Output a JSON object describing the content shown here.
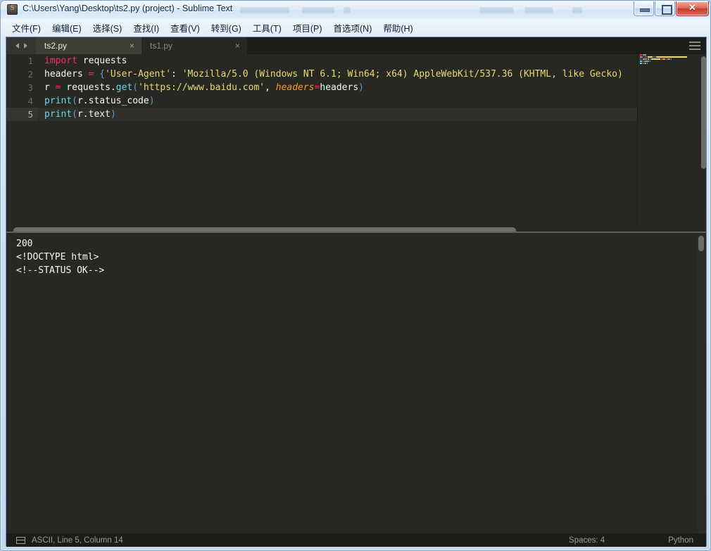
{
  "window": {
    "title": "C:\\Users\\Yang\\Desktop\\ts2.py (project) - Sublime Text",
    "app_icon": "sublime-text-icon",
    "buttons": {
      "minimize": "–",
      "maximize": "□",
      "close": "✕"
    }
  },
  "menu": {
    "items": [
      {
        "label": "文件(F)",
        "mnemonic": "F"
      },
      {
        "label": "编辑(E)",
        "mnemonic": "E"
      },
      {
        "label": "选择(S)",
        "mnemonic": "S"
      },
      {
        "label": "查找(I)",
        "mnemonic": "I"
      },
      {
        "label": "查看(V)",
        "mnemonic": "V"
      },
      {
        "label": "转到(G)",
        "mnemonic": "G"
      },
      {
        "label": "工具(T)",
        "mnemonic": "T"
      },
      {
        "label": "项目(P)",
        "mnemonic": "P"
      },
      {
        "label": "首选项(N)",
        "mnemonic": "N"
      },
      {
        "label": "帮助(H)",
        "mnemonic": "H"
      }
    ]
  },
  "tabs": {
    "nav_prev_icon": "chevron-left-icon",
    "nav_next_icon": "chevron-right-icon",
    "menu_icon": "hamburger-menu-icon",
    "close_icon": "×",
    "items": [
      {
        "label": "ts2.py",
        "active": true
      },
      {
        "label": "ts1.py",
        "active": false
      }
    ]
  },
  "editor": {
    "line_numbers": [
      "1",
      "2",
      "3",
      "4",
      "5"
    ],
    "current_line": 5,
    "lines": [
      {
        "n": 1,
        "tokens": [
          {
            "t": "import",
            "c": "k-import"
          },
          {
            "t": " requests",
            "c": "k-plain"
          }
        ]
      },
      {
        "n": 2,
        "tokens": [
          {
            "t": "headers ",
            "c": "k-plain"
          },
          {
            "t": "=",
            "c": "k-op"
          },
          {
            "t": " ",
            "c": "k-plain"
          },
          {
            "t": "{",
            "c": "k-punct"
          },
          {
            "t": "'User-Agent'",
            "c": "k-str"
          },
          {
            "t": ":",
            "c": "k-plain"
          },
          {
            "t": " ",
            "c": "k-plain"
          },
          {
            "t": "'Mozilla/5.0 (Windows NT 6.1; Win64; x64) AppleWebKit/537.36 (KHTML, like Gecko)",
            "c": "k-str"
          }
        ]
      },
      {
        "n": 3,
        "tokens": [
          {
            "t": "r ",
            "c": "k-plain"
          },
          {
            "t": "=",
            "c": "k-op"
          },
          {
            "t": " requests.",
            "c": "k-plain"
          },
          {
            "t": "get",
            "c": "k-call"
          },
          {
            "t": "(",
            "c": "k-punct"
          },
          {
            "t": "'https://www.baidu.com'",
            "c": "k-str"
          },
          {
            "t": ", ",
            "c": "k-plain"
          },
          {
            "t": "headers",
            "c": "k-param"
          },
          {
            "t": "=",
            "c": "k-op"
          },
          {
            "t": "headers",
            "c": "k-plain"
          },
          {
            "t": ")",
            "c": "k-punct"
          }
        ]
      },
      {
        "n": 4,
        "tokens": [
          {
            "t": "print",
            "c": "k-fn"
          },
          {
            "t": "(",
            "c": "k-punct"
          },
          {
            "t": "r.status_code",
            "c": "k-plain"
          },
          {
            "t": ")",
            "c": "k-punct"
          }
        ]
      },
      {
        "n": 5,
        "tokens": [
          {
            "t": "print",
            "c": "k-fn"
          },
          {
            "t": "(",
            "c": "k-punct"
          },
          {
            "t": "r.text",
            "c": "k-plain"
          },
          {
            "t": ")",
            "c": "k-punct"
          }
        ]
      }
    ]
  },
  "console": {
    "lines": [
      "200",
      "<!DOCTYPE html>",
      "<!--STATUS OK-->"
    ]
  },
  "statusbar": {
    "encoding_icon": "panel-layout-icon",
    "position": "ASCII, Line 5, Column 14",
    "indent": "Spaces: 4",
    "syntax": "Python"
  },
  "colors": {
    "editor_bg": "#272822",
    "tab_active_bg": "#3e3e37",
    "tabbar_bg": "#1c1d19",
    "keyword": "#f92672",
    "string": "#e6db74",
    "function": "#66d9ef",
    "param": "#fd971f",
    "punct": "#5a9fd4",
    "text": "#f8f8f2",
    "gutter_text": "#6d6c5f",
    "chrome_blue": "#b8cfe8"
  }
}
